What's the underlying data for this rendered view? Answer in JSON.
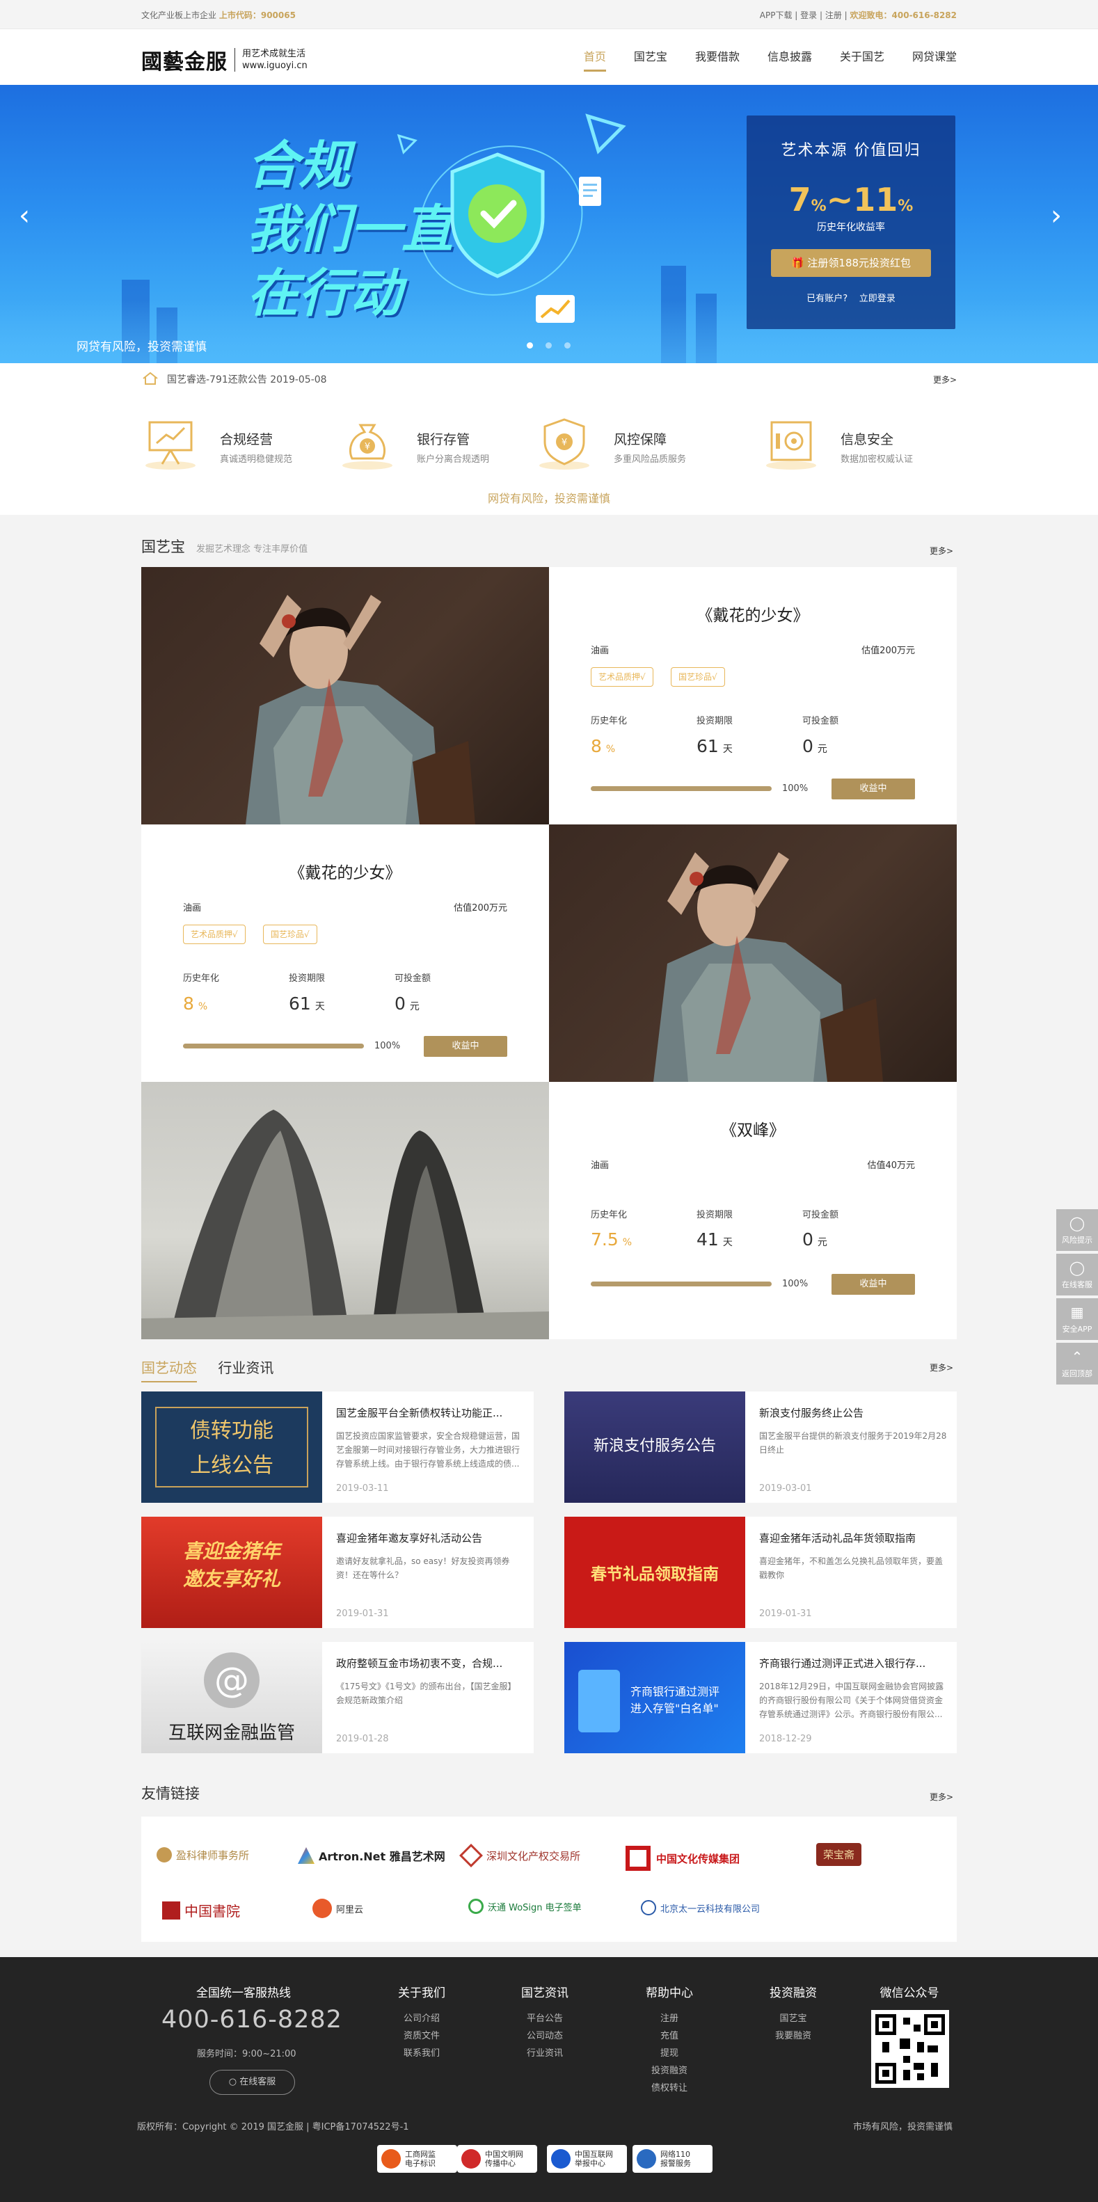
{
  "topbar": {
    "left_text": "文化产业板上市企业",
    "stock_label": "上市代码：",
    "stock_code": "900065",
    "app": "APP下载",
    "login": "登录",
    "register": "注册",
    "hotline_label": "欢迎致电：",
    "hotline": "400-616-8282"
  },
  "header": {
    "logo_main": "國藝金服",
    "logo_slogan": "用艺术成就生活",
    "logo_url": "www.iguoyi.cn",
    "nav": [
      "首页",
      "国艺宝",
      "我要借款",
      "信息披露",
      "关于国艺",
      "网贷课堂"
    ]
  },
  "banner": {
    "slogan_lines": [
      "合规",
      "我们一直",
      "在行动"
    ],
    "risk_note": "网贷有风险，投资需谨慎",
    "promo_title": "艺术本源  价值回归",
    "rate_low": "7",
    "rate_high": "11",
    "rate_unit": "%",
    "rate_label": "历史年化收益率",
    "promo_button": "注册领188元投资红包",
    "has_account": "已有账户?",
    "login_now": "立即登录"
  },
  "notice": {
    "text": "国艺睿选-791还款公告 2019-05-08",
    "more": "更多>"
  },
  "features": [
    {
      "title": "合规经营",
      "desc": "真诚透明稳健规范"
    },
    {
      "title": "银行存管",
      "desc": "账户分离合规透明"
    },
    {
      "title": "风控保障",
      "desc": "多重风险品质服务"
    },
    {
      "title": "信息安全",
      "desc": "数据加密权威认证"
    }
  ],
  "features_risk": "网贷有风险，投资需谨慎",
  "guoyibao": {
    "title": "国艺宝",
    "subtitle": "发掘艺术理念  专注丰厚价值",
    "more": "更多>",
    "labels": {
      "rate": "历史年化",
      "term": "投资期限",
      "available": "可投金额",
      "percent": "100%"
    },
    "products": [
      {
        "name": "《戴花的少女》",
        "category": "油画",
        "estimate": "估值200万元",
        "tags": [
          "艺术品质押√",
          "国艺珍品√"
        ],
        "rate": "8",
        "rate_unit": "%",
        "term": "61",
        "term_unit": "天",
        "available": "0",
        "available_unit": "元",
        "progress": 1.0,
        "status": "收益中"
      },
      {
        "name": "《戴花的少女》",
        "category": "油画",
        "estimate": "估值200万元",
        "tags": [
          "艺术品质押√",
          "国艺珍品√"
        ],
        "rate": "8",
        "rate_unit": "%",
        "term": "61",
        "term_unit": "天",
        "available": "0",
        "available_unit": "元",
        "progress": 1.0,
        "status": "收益中"
      },
      {
        "name": "《双峰》",
        "category": "油画",
        "estimate": "估值40万元",
        "tags": [],
        "rate": "7.5",
        "rate_unit": "%",
        "term": "41",
        "term_unit": "天",
        "available": "0",
        "available_unit": "元",
        "progress": 1.0,
        "status": "收益中"
      }
    ]
  },
  "news": {
    "tabs": [
      "国艺动态",
      "行业资讯"
    ],
    "more": "更多>",
    "items": [
      {
        "thumb_text": "债转功能\n上线公告",
        "title": "国艺金服平台全新债权转让功能正...",
        "desc": "国艺投资应国家监管要求，安全合规稳健运营，国艺金服第一时间对接银行存管业务，大力推进银行存管系统上线。由于银行存管系统上线造成的债...",
        "date": "2019-03-11"
      },
      {
        "thumb_text": "新浪支付服务公告",
        "title": "新浪支付服务终止公告",
        "desc": "国艺金服平台提供的新浪支付服务于2019年2月28日终止",
        "date": "2019-03-01"
      },
      {
        "thumb_text": "喜迎金猪年\n邀友享好礼",
        "title": "喜迎金猪年邀友享好礼活动公告",
        "desc": "邀请好友就拿礼品，so easy！好友投资再领券资！还在等什么？",
        "date": "2019-01-31"
      },
      {
        "thumb_text": "春节礼品领取指南",
        "title": "喜迎金猪年活动礼品年货领取指南",
        "desc": "喜迎金猪年，不和盖怎么兑换礼品领取年货，要盖戳教你",
        "date": "2019-01-31"
      },
      {
        "thumb_text": "互联网金融监管",
        "title": "政府整顿互金市场初衷不变，合规...",
        "desc": "《175号文》《1号文》的颁布出台，【国艺金服】会规范新政策介绍",
        "date": "2019-01-28"
      },
      {
        "thumb_text": "齐商银行通过测评\n进入存管\"白名单\"",
        "title": "齐商银行通过测评正式进入银行存...",
        "desc": "2018年12月29日，中国互联网金融协会官网披露的齐商银行股份有限公司《关于个体网贷借贷资金存管系统通过测评》公示。齐商银行股份有限公...",
        "date": "2018-12-29"
      }
    ]
  },
  "links": {
    "title": "友情链接",
    "more": "更多>",
    "items": [
      "盈科律师事务所",
      "Artron.Net 雅昌艺术网",
      "深圳文化产权交易所",
      "中国文化传媒集团",
      "荣宝斋",
      "中国書院",
      "阿里云",
      "沃通 WoSign 电子签单",
      "北京太一云科技有限公司"
    ]
  },
  "footer": {
    "hotline_title": "全国统一客服热线",
    "hotline": "400-616-8282",
    "service_time": "服务时间：9:00~21:00",
    "online_service": "在线客服",
    "columns": [
      {
        "title": "关于我们",
        "items": [
          "公司介绍",
          "资质文件",
          "联系我们"
        ]
      },
      {
        "title": "国艺资讯",
        "items": [
          "平台公告",
          "公司动态",
          "行业资讯"
        ]
      },
      {
        "title": "帮助中心",
        "items": [
          "注册",
          "充值",
          "提现",
          "投资融资",
          "债权转让"
        ]
      },
      {
        "title": "投资融资",
        "items": [
          "国艺宝",
          "我要融资"
        ]
      },
      {
        "title": "微信公众号",
        "items": []
      }
    ],
    "copyright": "版权所有：Copyright © 2019 国艺金服 | 粤ICP备17074522号-1",
    "risk": "市场有风险，投资需谨慎",
    "badges": [
      "工商网监\n电子标识",
      "中国文明网\n传播中心",
      "中国互联网\n举报中心",
      "网络110\n报警服务"
    ]
  },
  "side": [
    "风险提示",
    "在线客服",
    "安全APP",
    "返回顶部"
  ],
  "colors": {
    "gold": "#c8a45c",
    "banner_blue": "#2b8ff0",
    "footer": "#242424"
  }
}
